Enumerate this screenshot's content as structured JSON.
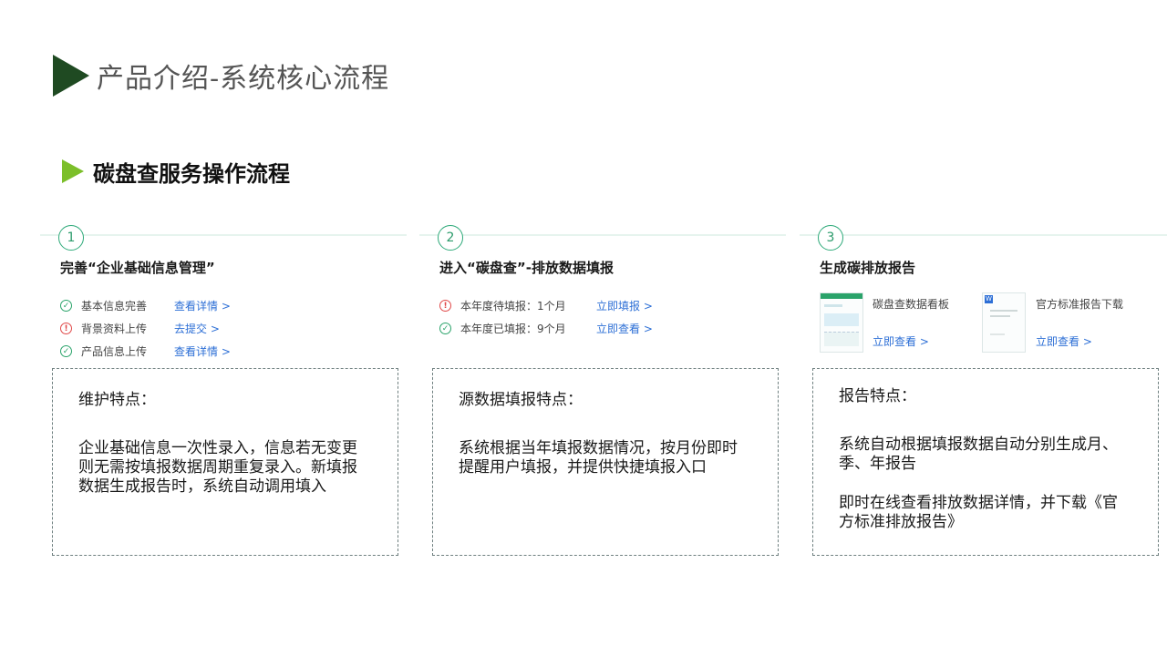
{
  "header": {
    "title": "产品介绍-系统核心流程",
    "subtitle": "碳盘查服务操作流程"
  },
  "cards": [
    {
      "num": "1",
      "title": "完善“企业基础信息管理”",
      "rows": [
        {
          "status": "ok",
          "label": "基本信息完善",
          "link": "查看详情 >"
        },
        {
          "status": "warn",
          "label": "背景资料上传",
          "link": "去提交 >"
        },
        {
          "status": "ok",
          "label": "产品信息上传",
          "link": "查看详情 >"
        }
      ]
    },
    {
      "num": "2",
      "title": "进入“碳盘查”-排放数据填报",
      "rows": [
        {
          "status": "warn",
          "label": "本年度待填报：1个月",
          "link": "立即填报 >"
        },
        {
          "status": "ok",
          "label": "本年度已填报：9个月",
          "link": "立即查看 >"
        }
      ]
    },
    {
      "num": "3",
      "title": "生成碳排放报告",
      "reports": [
        {
          "label": "碳盘查数据看板",
          "link": "立即查看 >",
          "icon": "dashboard-thumbnail"
        },
        {
          "label": "官方标准报告下载",
          "link": "立即查看 >",
          "icon": "word-document-thumbnail"
        }
      ]
    }
  ],
  "features": [
    {
      "head": "维护特点：",
      "paragraphs": [
        "企业基础信息一次性录入，信息若无变更则无需按填报数据周期重复录入。新填报数据生成报告时，系统自动调用填入"
      ]
    },
    {
      "head": "源数据填报特点：",
      "paragraphs": [
        "系统根据当年填报数据情况，按月份即时提醒用户填报，并提供快捷填报入口"
      ]
    },
    {
      "head": "报告特点：",
      "paragraphs": [
        "系统自动根据填报数据自动分别生成月、季、年报告",
        "即时在线查看排放数据详情，并下载《官方标准排放报告》"
      ]
    }
  ],
  "icons": {
    "ok": "check-circle-icon",
    "warn": "exclamation-circle-icon"
  },
  "colors": {
    "title_triangle": "#1f4a22",
    "subtitle_triangle": "#7cbf2a",
    "link": "#2d6fd6",
    "ok": "#2aa36a",
    "warn": "#e04848"
  }
}
